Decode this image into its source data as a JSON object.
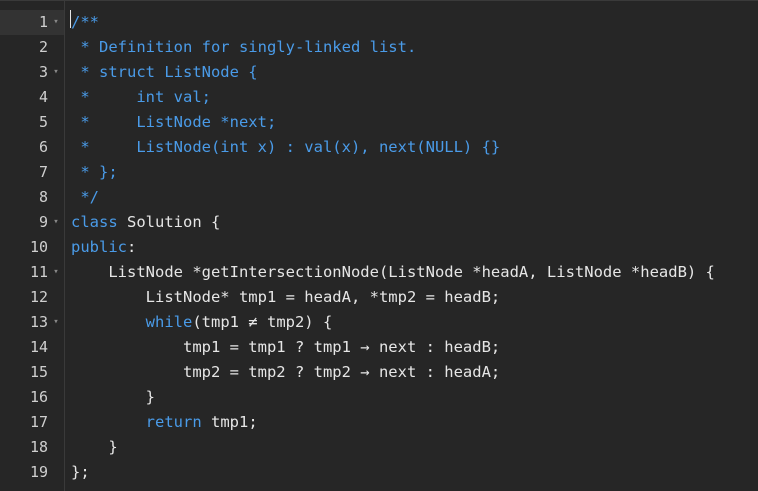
{
  "editor": {
    "lines": [
      {
        "num": "1",
        "fold": true,
        "tokens": [
          {
            "t": "/**",
            "c": "comment"
          }
        ]
      },
      {
        "num": "2",
        "fold": false,
        "tokens": [
          {
            "t": " * Definition for singly-linked list.",
            "c": "comment"
          }
        ]
      },
      {
        "num": "3",
        "fold": true,
        "tokens": [
          {
            "t": " * struct ListNode {",
            "c": "comment"
          }
        ]
      },
      {
        "num": "4",
        "fold": false,
        "tokens": [
          {
            "t": " *     int val;",
            "c": "comment"
          }
        ]
      },
      {
        "num": "5",
        "fold": false,
        "tokens": [
          {
            "t": " *     ListNode *next;",
            "c": "comment"
          }
        ]
      },
      {
        "num": "6",
        "fold": false,
        "tokens": [
          {
            "t": " *     ListNode(int x) : val(x), next(NULL) {}",
            "c": "comment"
          }
        ]
      },
      {
        "num": "7",
        "fold": false,
        "tokens": [
          {
            "t": " * };",
            "c": "comment"
          }
        ]
      },
      {
        "num": "8",
        "fold": false,
        "tokens": [
          {
            "t": " */",
            "c": "comment"
          }
        ]
      },
      {
        "num": "9",
        "fold": true,
        "tokens": [
          {
            "t": "class",
            "c": "keyword"
          },
          {
            "t": " Solution {",
            "c": "plain"
          }
        ]
      },
      {
        "num": "10",
        "fold": false,
        "tokens": [
          {
            "t": "public",
            "c": "keyword"
          },
          {
            "t": ":",
            "c": "plain"
          }
        ]
      },
      {
        "num": "11",
        "fold": true,
        "tokens": [
          {
            "t": "    ListNode *getIntersectionNode(ListNode *headA, ListNode *headB) {",
            "c": "plain"
          }
        ]
      },
      {
        "num": "12",
        "fold": false,
        "tokens": [
          {
            "t": "        ListNode* tmp1 = headA, *tmp2 = headB;",
            "c": "plain"
          }
        ]
      },
      {
        "num": "13",
        "fold": true,
        "tokens": [
          {
            "t": "        ",
            "c": "plain"
          },
          {
            "t": "while",
            "c": "keyword"
          },
          {
            "t": "(tmp1 ≠ tmp2) {",
            "c": "plain"
          }
        ]
      },
      {
        "num": "14",
        "fold": false,
        "tokens": [
          {
            "t": "            tmp1 = tmp1 ? tmp1 → next : headB;",
            "c": "plain"
          }
        ]
      },
      {
        "num": "15",
        "fold": false,
        "tokens": [
          {
            "t": "            tmp2 = tmp2 ? tmp2 → next : headA;",
            "c": "plain"
          }
        ]
      },
      {
        "num": "16",
        "fold": false,
        "tokens": [
          {
            "t": "        }",
            "c": "plain"
          }
        ]
      },
      {
        "num": "17",
        "fold": false,
        "tokens": [
          {
            "t": "        ",
            "c": "plain"
          },
          {
            "t": "return",
            "c": "keyword"
          },
          {
            "t": " tmp1;",
            "c": "plain"
          }
        ]
      },
      {
        "num": "18",
        "fold": false,
        "tokens": [
          {
            "t": "    }",
            "c": "plain"
          }
        ]
      },
      {
        "num": "19",
        "fold": false,
        "tokens": [
          {
            "t": "};",
            "c": "plain"
          }
        ]
      }
    ],
    "active_line": "1",
    "colors": {
      "background": "#262626",
      "comment": "#4a9be8",
      "keyword": "#4a9be8",
      "text": "#e6e6e6",
      "gutter_text": "#cfcfcf"
    },
    "icons": {
      "fold": "chevron-down-icon"
    }
  }
}
